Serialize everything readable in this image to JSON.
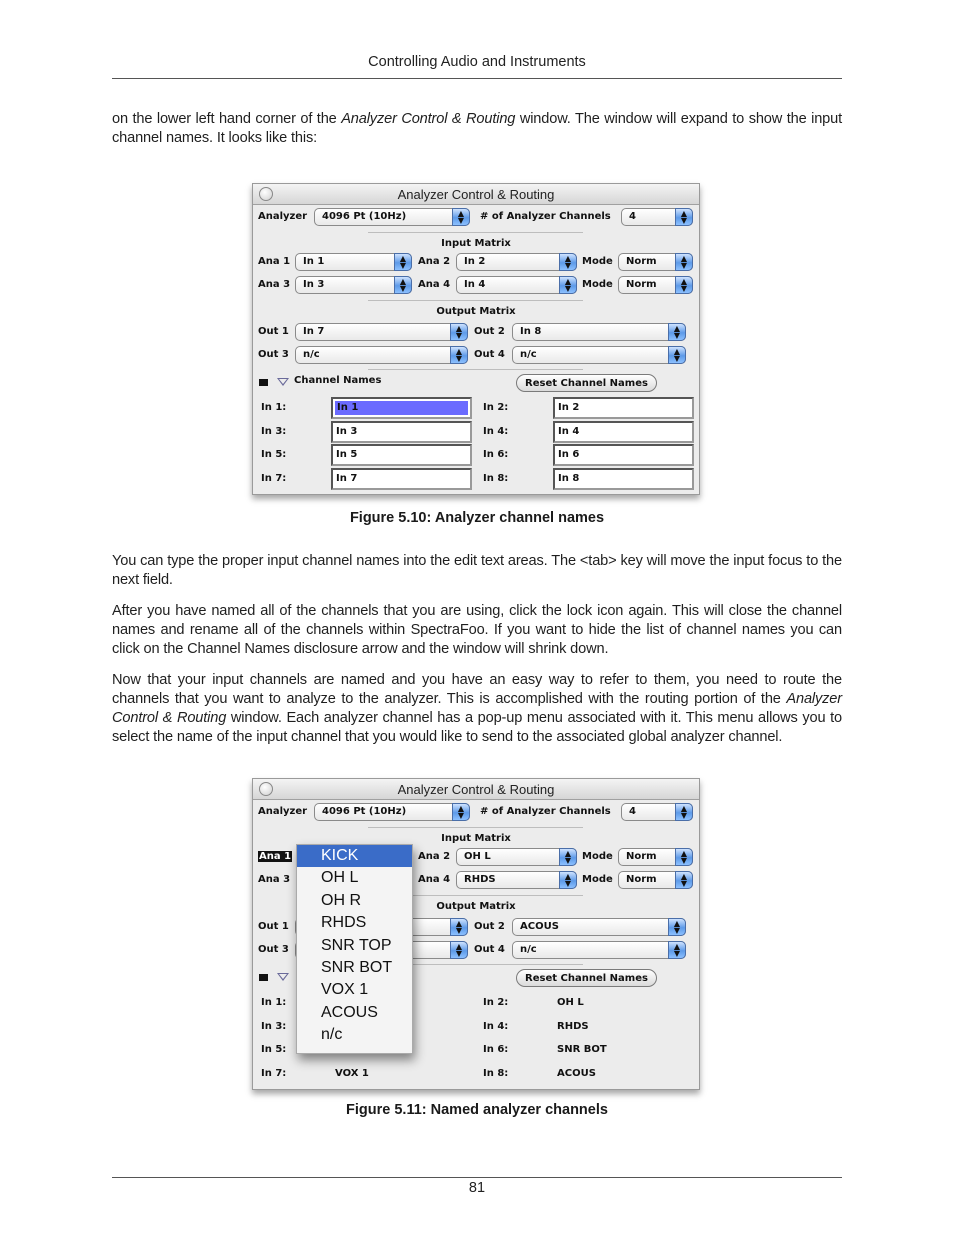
{
  "header": {
    "title": "Controlling Audio and Instruments"
  },
  "paragraphs": {
    "p1_a": "on the lower left hand corner of the ",
    "p1_i": "Analyzer Control & Routing",
    "p1_b": " window. The window will expand to show the input channel names. It looks like this:",
    "p2": "You can type the proper input channel names into the edit text areas. The <tab> key will move the input focus to the next field.",
    "p3": "After you have named all of the channels that you are using, click the lock icon again. This will close the channel names and rename all of the channels within SpectraFoo. If you want to hide the list of channel names you can click on the Channel Names disclosure arrow and the window will shrink down.",
    "p4_a": "Now that your input channels are named and you have an easy way to refer to them, you need to route the channels that you want to analyze to the analyzer. This is accomplished with the routing portion of the ",
    "p4_i": "Analyzer Control & Routing",
    "p4_b": " window. Each analyzer channel has a pop-up menu associated with it. This menu allows you to select the name of the input channel that you would like to send to the associated global analyzer channel."
  },
  "figure1": {
    "caption": "Figure 5.10: Analyzer channel names",
    "window_title": "Analyzer Control & Routing",
    "analyzer_label": "Analyzer",
    "analyzer_value": "4096 Pt (10Hz)",
    "channels_label": "# of Analyzer Channels",
    "channels_value": "4",
    "input_matrix_title": "Input Matrix",
    "ana1_label": "Ana 1",
    "ana1_value": "In 1",
    "ana2_label": "Ana 2",
    "ana2_value": "In 2",
    "ana3_label": "Ana 3",
    "ana3_value": "In 3",
    "ana4_label": "Ana 4",
    "ana4_value": "In 4",
    "mode_label": "Mode",
    "mode1_value": "Norm",
    "mode2_value": "Norm",
    "output_matrix_title": "Output Matrix",
    "out1_label": "Out 1",
    "out1_value": "In 7",
    "out2_label": "Out 2",
    "out2_value": "In 8",
    "out3_label": "Out 3",
    "out3_value": "n/c",
    "out4_label": "Out 4",
    "out4_value": "n/c",
    "channel_names_label": "Channel Names",
    "reset_button": "Reset Channel Names",
    "inputs": [
      {
        "label": "In 1:",
        "value": "In 1"
      },
      {
        "label": "In 2:",
        "value": "In 2"
      },
      {
        "label": "In 3:",
        "value": "In 3"
      },
      {
        "label": "In 4:",
        "value": "In 4"
      },
      {
        "label": "In 5:",
        "value": "In 5"
      },
      {
        "label": "In 6:",
        "value": "In 6"
      },
      {
        "label": "In 7:",
        "value": "In 7"
      },
      {
        "label": "In 8:",
        "value": "In 8"
      }
    ]
  },
  "figure2": {
    "caption": "Figure 5.11: Named analyzer channels",
    "window_title": "Analyzer Control & Routing",
    "analyzer_label": "Analyzer",
    "analyzer_value": "4096 Pt (10Hz)",
    "channels_label": "# of Analyzer Channels",
    "channels_value": "4",
    "input_matrix_title": "Input Matrix",
    "ana1_label": "Ana 1",
    "ana2_label": "Ana 2",
    "ana2_value": "OH L",
    "ana3_label": "Ana 3",
    "ana4_label": "Ana 4",
    "ana4_value": "RHDS",
    "mode_label": "Mode",
    "mode1_value": "Norm",
    "mode2_value": "Norm",
    "output_matrix_title": "Output Matrix",
    "out1_label": "Out 1",
    "out2_label": "Out 2",
    "out2_value": "ACOUS",
    "out3_label": "Out 3",
    "out4_label": "Out 4",
    "out4_value": "n/c",
    "reset_button": "Reset Channel Names",
    "inputs": [
      {
        "label": "In 1:",
        "value": "KICK"
      },
      {
        "label": "In 2:",
        "value": "OH L"
      },
      {
        "label": "In 3:",
        "value": "OH R"
      },
      {
        "label": "In 4:",
        "value": "RHDS"
      },
      {
        "label": "In 5:",
        "value": "SNR TOP"
      },
      {
        "label": "In 6:",
        "value": "SNR BOT"
      },
      {
        "label": "In 7:",
        "value": "VOX 1"
      },
      {
        "label": "In 8:",
        "value": "ACOUS"
      }
    ],
    "menu_items": [
      "KICK",
      "OH L",
      "OH R",
      "RHDS",
      "SNR TOP",
      "SNR BOT",
      "VOX 1",
      "ACOUS",
      "n/c"
    ],
    "menu_selected": "KICK"
  },
  "footer": {
    "page_number": "81"
  }
}
